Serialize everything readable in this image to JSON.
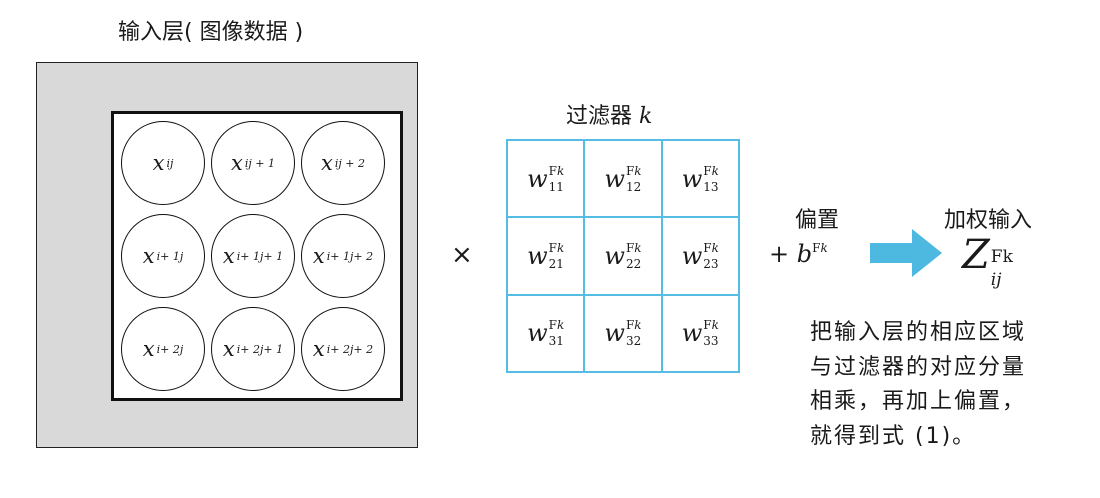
{
  "input_layer": {
    "title": "输入层( 图像数据 )",
    "neurons": [
      {
        "var": "x",
        "sub": "ij"
      },
      {
        "var": "x",
        "sub": "ij + 1"
      },
      {
        "var": "x",
        "sub": "ij + 2"
      },
      {
        "var": "x",
        "sub": "i+ 1j"
      },
      {
        "var": "x",
        "sub": "i+ 1j+ 1"
      },
      {
        "var": "x",
        "sub": "i+ 1j+ 2"
      },
      {
        "var": "x",
        "sub": "i+ 2j"
      },
      {
        "var": "x",
        "sub": "i+ 2j+ 1"
      },
      {
        "var": "x",
        "sub": "i+ 2j+ 2"
      }
    ],
    "colors": {
      "panel": "#d9d9d9",
      "region_border": "#111111"
    }
  },
  "operator_times": "×",
  "filter": {
    "title_text": "过滤器",
    "title_var": "k",
    "weights": [
      {
        "var": "w",
        "sup": "F",
        "sup_var": "k",
        "sub": "11"
      },
      {
        "var": "w",
        "sup": "F",
        "sup_var": "k",
        "sub": "12"
      },
      {
        "var": "w",
        "sup": "F",
        "sup_var": "k",
        "sub": "13"
      },
      {
        "var": "w",
        "sup": "F",
        "sup_var": "k",
        "sub": "21"
      },
      {
        "var": "w",
        "sup": "F",
        "sup_var": "k",
        "sub": "22"
      },
      {
        "var": "w",
        "sup": "F",
        "sup_var": "k",
        "sub": "23"
      },
      {
        "var": "w",
        "sup": "F",
        "sup_var": "k",
        "sub": "31"
      },
      {
        "var": "w",
        "sup": "F",
        "sup_var": "k",
        "sub": "32"
      },
      {
        "var": "w",
        "sup": "F",
        "sup_var": "k",
        "sub": "33"
      }
    ],
    "colors": {
      "grid_line": "#55bde3"
    }
  },
  "bias": {
    "title": "偏置",
    "plus": "+",
    "var": "b",
    "sup": "F",
    "sup_var": "k"
  },
  "arrow": {
    "icon": "right-arrow-icon",
    "color": "#4db8e0"
  },
  "weighted_input": {
    "title": "加权输入",
    "var": "Z",
    "sup": "Fk",
    "sub": "ij"
  },
  "note": {
    "lines": [
      "把输入层的相应区域",
      "与过滤器的对应分量",
      "相乘，再加上偏置，",
      "就得到式 (1)。"
    ]
  }
}
